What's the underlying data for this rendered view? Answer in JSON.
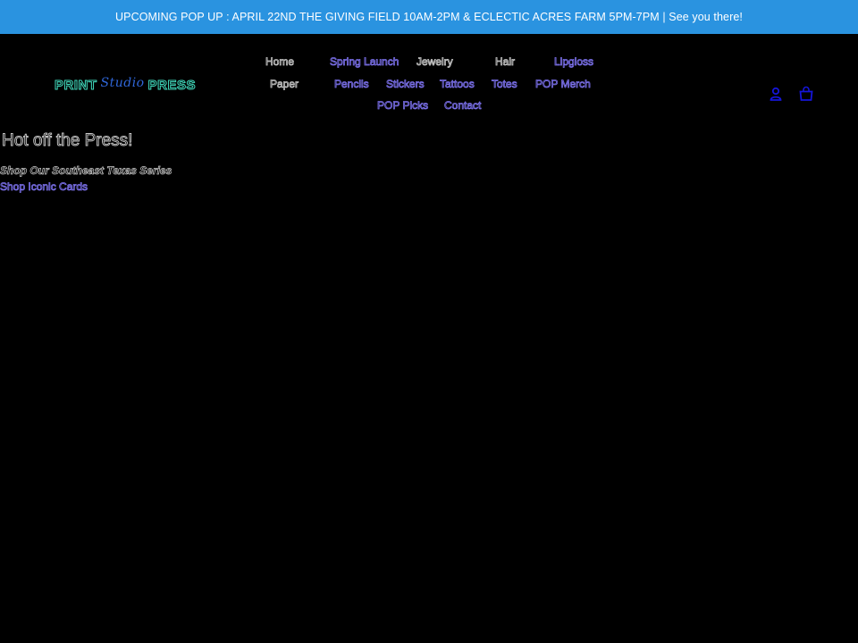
{
  "announcement": {
    "text": "UPCOMING POP UP : APRIL 22ND THE GIVING FIELD 10AM-2PM & ECLECTIC ACRES FARM 5PM-7PM | See you there!"
  },
  "logo": {
    "part1": "PRINT",
    "part2": "Studio",
    "part3": "PRESS"
  },
  "nav": {
    "items": [
      {
        "label": "Home"
      },
      {
        "label": "Spring Launch"
      },
      {
        "label": "Jewelry"
      },
      {
        "label": "Hair"
      },
      {
        "label": "Lipgloss"
      },
      {
        "label": "Paper"
      },
      {
        "label": "Pencils"
      },
      {
        "label": "Stickers"
      },
      {
        "label": "Tattoos"
      },
      {
        "label": "Totes"
      },
      {
        "label": "POP Merch"
      },
      {
        "label": "POP Picks"
      },
      {
        "label": "Contact"
      }
    ]
  },
  "header_icons": {
    "account": "account-icon",
    "cart": "cart-icon"
  },
  "main": {
    "heading": "Hot off the Press!",
    "links": [
      {
        "label": "Shop Our Southeast Texas Series"
      },
      {
        "label": "Shop Iconic Cards"
      }
    ]
  },
  "colors": {
    "announcement_bg": "#2a93e0",
    "link_blue": "#7e73f0",
    "icon_blue": "#1515d8",
    "logo_teal": "#3fd5b8",
    "background": "#000000"
  }
}
